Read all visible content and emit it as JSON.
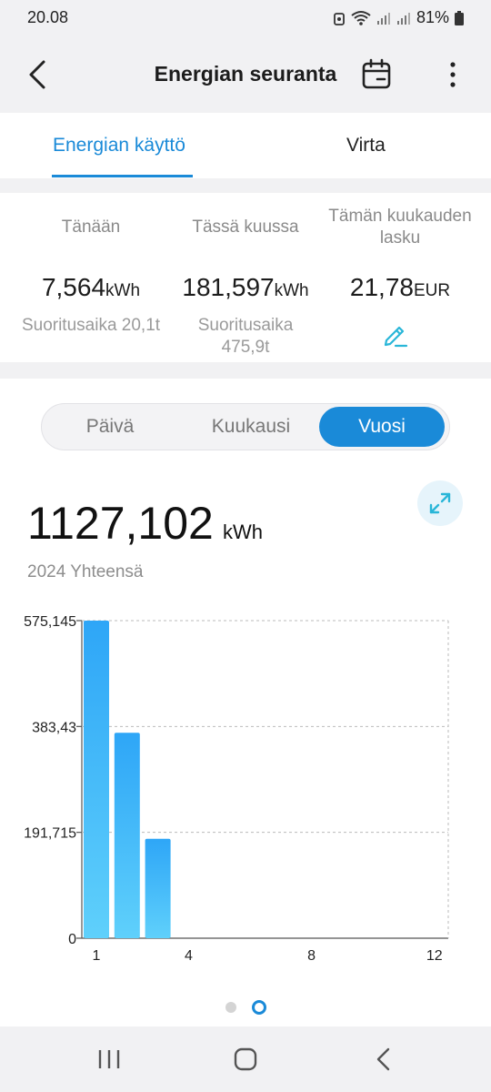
{
  "status": {
    "time": "20.08",
    "battery": "81%"
  },
  "header": {
    "title": "Energian seuranta"
  },
  "tabs": [
    {
      "label": "Energian käyttö",
      "active": true
    },
    {
      "label": "Virta",
      "active": false
    }
  ],
  "summary": {
    "today": {
      "label": "Tänään",
      "value": "7,564",
      "unit": "kWh",
      "sub": "Suoritusaika 20,1t"
    },
    "month": {
      "label": "Tässä kuussa",
      "value": "181,597",
      "unit": "kWh",
      "sub": "Suoritusaika 475,9t"
    },
    "bill": {
      "label": "Tämän kuukauden lasku",
      "value": "21,78",
      "unit": "EUR"
    }
  },
  "period_selector": {
    "options": [
      "Päivä",
      "Kuukausi",
      "Vuosi"
    ],
    "selected": "Vuosi"
  },
  "total": {
    "value": "1127,102",
    "unit": "kWh",
    "caption": "2024 Yhteensä"
  },
  "colors": {
    "accent": "#1a8ad8",
    "bar_top": "#2ea6f7",
    "bar_bottom": "#5fd0fb"
  },
  "chart_data": {
    "type": "bar",
    "categories": [
      1,
      2,
      3,
      4,
      5,
      6,
      7,
      8,
      9,
      10,
      11,
      12
    ],
    "values": [
      575.145,
      372.0,
      180.0,
      0,
      0,
      0,
      0,
      0,
      0,
      0,
      0,
      0
    ],
    "y_ticks": [
      "575,145",
      "383,43",
      "191,715",
      "0"
    ],
    "y_tick_values": [
      575.145,
      383.43,
      191.715,
      0
    ],
    "x_ticks": [
      "1",
      "4",
      "8",
      "12"
    ],
    "x_tick_values": [
      1,
      4,
      8,
      12
    ],
    "ylim": [
      0,
      575.145
    ],
    "grid": true
  },
  "pager": {
    "pages": 2,
    "current": 2
  }
}
